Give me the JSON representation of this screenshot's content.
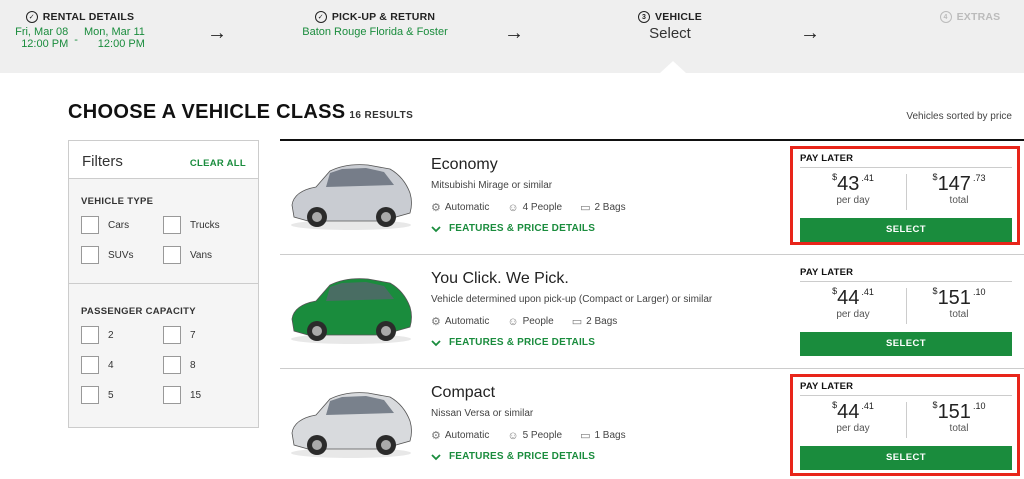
{
  "progress": {
    "steps": [
      {
        "label": "RENTAL DETAILS",
        "pickup_date": "Fri, Mar 08",
        "pickup_time": "12:00 PM",
        "dash": "-",
        "return_date": "Mon, Mar 11",
        "return_time": "12:00 PM"
      },
      {
        "label": "PICK-UP & RETURN",
        "location": "Baton Rouge Florida & Foster"
      },
      {
        "number": "3",
        "label": "VEHICLE",
        "sub": "Select"
      },
      {
        "number": "4",
        "label": "EXTRAS"
      }
    ],
    "arrow": "→"
  },
  "page": {
    "title": "CHOOSE A VEHICLE CLASS",
    "results": "16 RESULTS",
    "sorted": "Vehicles sorted by price"
  },
  "filters": {
    "title": "Filters",
    "clear_all": "CLEAR ALL",
    "vehicle_type": {
      "title": "VEHICLE TYPE",
      "options": [
        "Cars",
        "Trucks",
        "SUVs",
        "Vans"
      ]
    },
    "passenger_capacity": {
      "title": "PASSENGER CAPACITY",
      "options": [
        "2",
        "7",
        "4",
        "8",
        "5",
        "15"
      ]
    }
  },
  "vehicles": [
    {
      "name": "Economy",
      "model": "Mitsubishi Mirage or similar",
      "transmission": "Automatic",
      "people": "4 People",
      "bags": "2 Bags",
      "details": "FEATURES & PRICE DETAILS",
      "pay_label": "PAY LATER",
      "currency": "$",
      "day_price": "43",
      "day_cents": ".41",
      "day_label": "per day",
      "total_price": "147",
      "total_cents": ".73",
      "total_label": "total",
      "select": "SELECT",
      "car_color": "#c9ccd2"
    },
    {
      "name": "You Click. We Pick.",
      "model": "Vehicle determined upon pick-up (Compact or Larger) or similar",
      "transmission": "Automatic",
      "people": "People",
      "bags": "2 Bags",
      "details": "FEATURES & PRICE DETAILS",
      "pay_label": "PAY LATER",
      "currency": "$",
      "day_price": "44",
      "day_cents": ".41",
      "day_label": "per day",
      "total_price": "151",
      "total_cents": ".10",
      "total_label": "total",
      "select": "SELECT",
      "car_color": "#1a8c3d"
    },
    {
      "name": "Compact",
      "model": "Nissan Versa or similar",
      "transmission": "Automatic",
      "people": "5 People",
      "bags": "1 Bags",
      "details": "FEATURES & PRICE DETAILS",
      "pay_label": "PAY LATER",
      "currency": "$",
      "day_price": "44",
      "day_cents": ".41",
      "day_label": "per day",
      "total_price": "151",
      "total_cents": ".10",
      "total_label": "total",
      "select": "SELECT",
      "car_color": "#d8dadd"
    }
  ],
  "colors": {
    "brand_green": "#1a8c3d",
    "highlight_red": "#e8251a"
  }
}
